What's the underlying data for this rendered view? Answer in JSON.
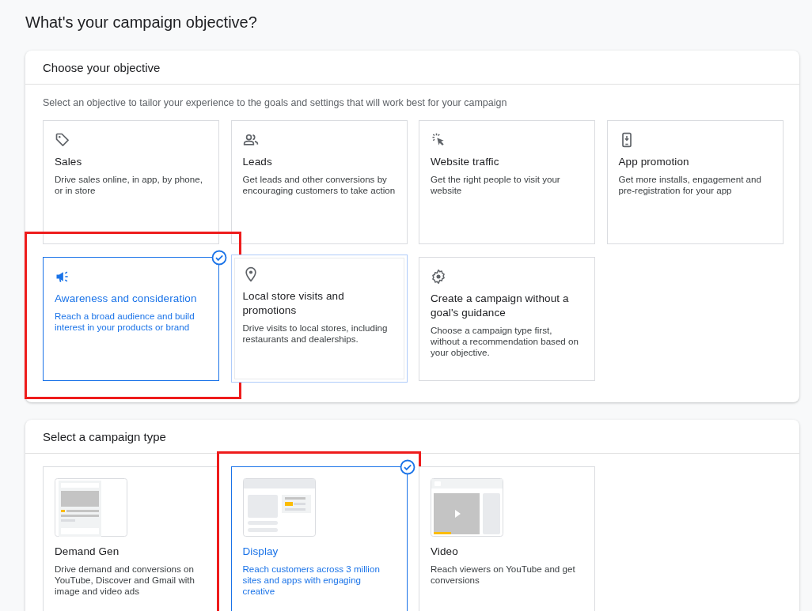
{
  "page_title": "What's your campaign objective?",
  "objective_panel": {
    "title": "Choose your objective",
    "description": "Select an objective to tailor your experience to the goals and settings that will work best for your campaign",
    "objectives": [
      {
        "kind": "tag",
        "title": "Sales",
        "description": "Drive sales online, in app, by phone, or in store",
        "selected": false,
        "hovered": false,
        "annotated": false
      },
      {
        "kind": "people",
        "title": "Leads",
        "description": "Get leads and other conversions by encouraging customers to take action",
        "selected": false,
        "hovered": false,
        "annotated": false
      },
      {
        "kind": "cursor",
        "title": "Website traffic",
        "description": "Get the right people to visit your website",
        "selected": false,
        "hovered": false,
        "annotated": false
      },
      {
        "kind": "phone",
        "title": "App promotion",
        "description": "Get more installs, engagement and pre-registration for your app",
        "selected": false,
        "hovered": false,
        "annotated": false
      },
      {
        "kind": "megaphone",
        "title": "Awareness and consideration",
        "description": "Reach a broad audience and build interest in your products or brand",
        "selected": true,
        "hovered": false,
        "annotated": true
      },
      {
        "kind": "pin",
        "title": "Local store visits and promotions",
        "description": "Drive visits to local stores, including restaurants and dealerships.",
        "selected": false,
        "hovered": true,
        "annotated": false
      },
      {
        "kind": "gear",
        "title": "Create a campaign without a goal's guidance",
        "description": "Choose a campaign type first, without a recommendation based on your objective.",
        "selected": false,
        "hovered": false,
        "annotated": false
      }
    ]
  },
  "campaign_type_panel": {
    "title": "Select a campaign type",
    "types": [
      {
        "kind": "demand-gen",
        "title": "Demand Gen",
        "description": "Drive demand and conversions on YouTube, Discover and Gmail with image and video ads",
        "selected": false,
        "annotated": false
      },
      {
        "kind": "display",
        "title": "Display",
        "description": "Reach customers across 3 million sites and apps with engaging creative",
        "selected": true,
        "annotated": true
      },
      {
        "kind": "video",
        "title": "Video",
        "description": "Reach viewers on YouTube and get conversions",
        "selected": false,
        "annotated": false
      }
    ]
  }
}
